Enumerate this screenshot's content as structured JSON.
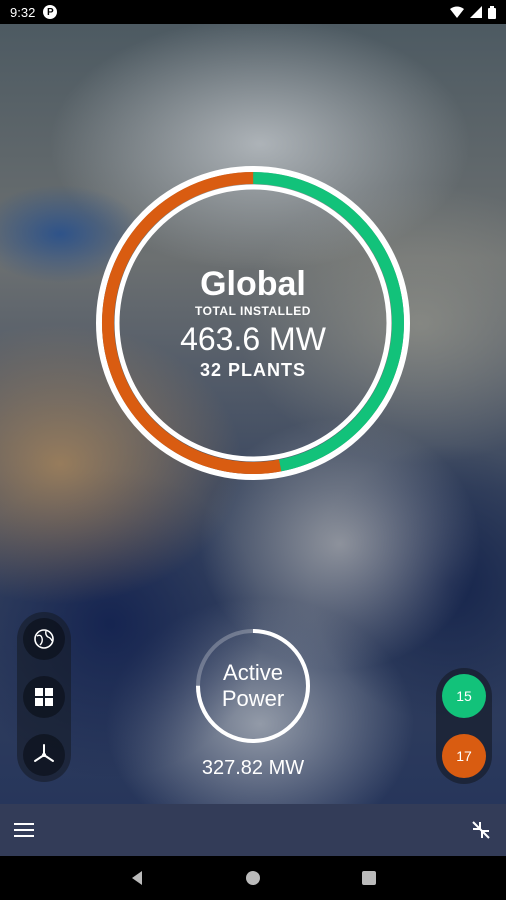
{
  "status_bar": {
    "time": "9:32",
    "badge": "P"
  },
  "summary": {
    "title": "Global",
    "subtitle": "TOTAL INSTALLED",
    "capacity": "463.6 MW",
    "plants": "32 PLANTS",
    "ring": {
      "orange_fraction": 0.53,
      "green_fraction": 0.47,
      "orange_color": "#d95c11",
      "green_color": "#12c27a"
    }
  },
  "active_power": {
    "label_line1": "Active",
    "label_line2": "Power",
    "value": "327.82 MW",
    "progress": 0.75
  },
  "status_counts": [
    {
      "value": "15",
      "color": "#12c27a"
    },
    {
      "value": "17",
      "color": "#d95c11"
    }
  ],
  "left_buttons": [
    {
      "icon": "globe-icon"
    },
    {
      "icon": "grid-icon"
    },
    {
      "icon": "wind-turbine-icon"
    }
  ],
  "bottom_bar": {
    "left_icon": "menu-icon",
    "right_icon": "collapse-icon"
  },
  "nav": [
    "back-icon",
    "home-icon",
    "recents-icon"
  ]
}
